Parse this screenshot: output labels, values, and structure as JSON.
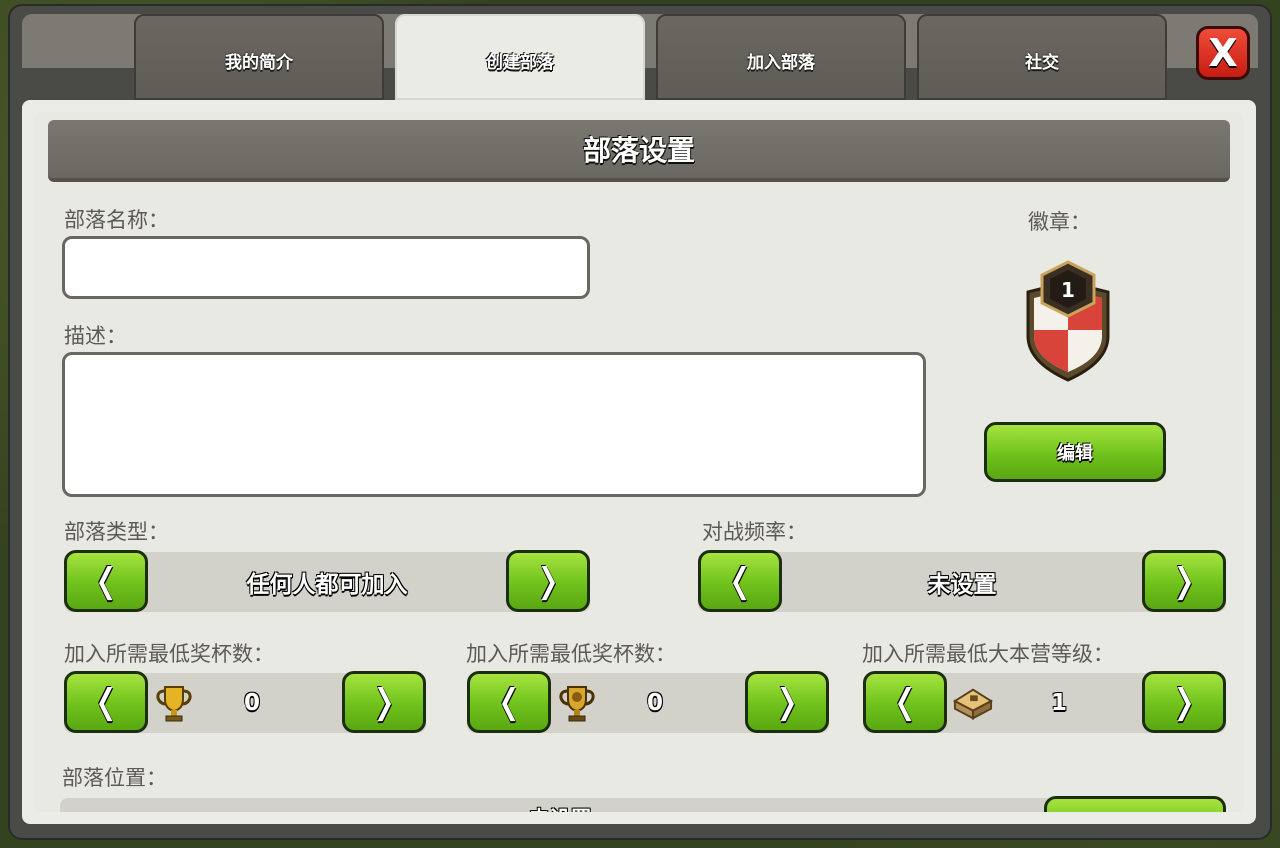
{
  "tabs": [
    {
      "label": "我的简介"
    },
    {
      "label": "创建部落"
    },
    {
      "label": "加入部落"
    },
    {
      "label": "社交"
    }
  ],
  "active_tab": "创建部落",
  "close_label": "X",
  "header": {
    "title": "部落设置"
  },
  "form": {
    "clan_name_label": "部落名称：",
    "clan_name_value": "",
    "description_label": "描述：",
    "description_value": "",
    "badge_label": "徽章：",
    "badge_level": "1",
    "edit_button": "编辑",
    "clan_type_label": "部落类型：",
    "clan_type_value": "任何人都可加入",
    "war_frequency_label": "对战频率：",
    "war_frequency_value": "未设置",
    "min_trophies_label": "加入所需最低奖杯数：",
    "min_trophies_value": "0",
    "min_builder_trophies_label": "加入所需最低奖杯数：",
    "min_builder_trophies_value": "0",
    "min_th_label": "加入所需最低大本营等级：",
    "min_th_value": "1",
    "location_label": "部落位置：",
    "location_value": "未设置",
    "arrow_left": "❬",
    "arrow_right": "❭"
  },
  "colors": {
    "green_button": "#6fc21c",
    "close_red": "#d22a1c",
    "panel": "#e9e9e3",
    "header_bar": "#716e68"
  },
  "icons": [
    "close-icon",
    "clan-badge-icon",
    "trophy-icon",
    "builder-trophy-icon",
    "town-hall-icon"
  ]
}
